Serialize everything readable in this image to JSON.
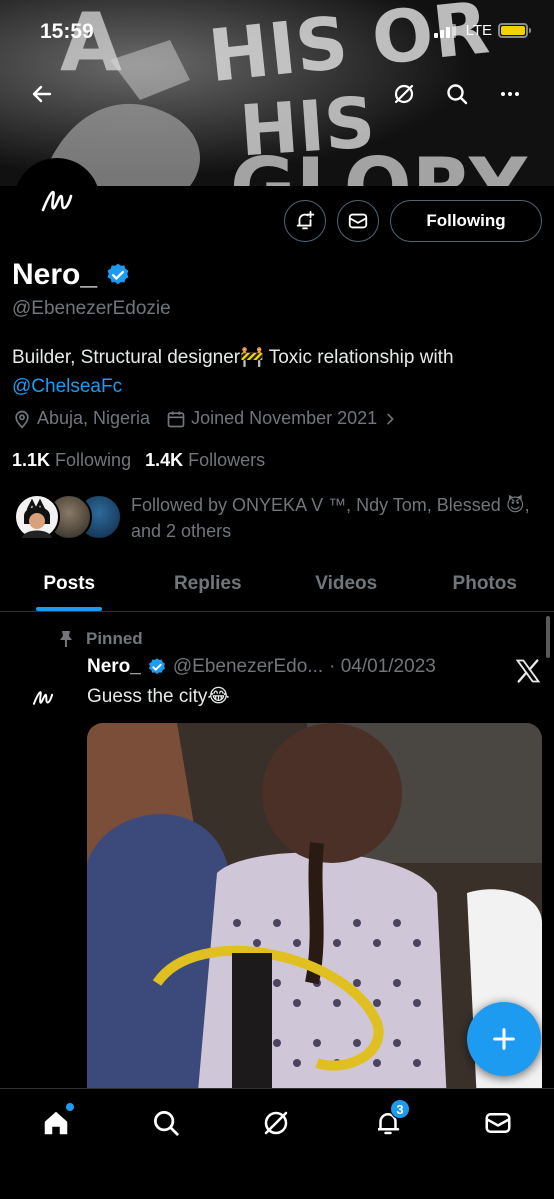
{
  "status_bar": {
    "time": "15:59",
    "network": "LTE"
  },
  "banner": {
    "art_text": [
      "A",
      "HIS OR",
      "HIS",
      "GLORY"
    ]
  },
  "profile": {
    "name": "Nero_",
    "handle": "@EbenezerEdozie",
    "bio_text": "Builder, Structural designer🚧 Toxic relationship with",
    "bio_link": "@ChelseaFc",
    "location": "Abuja, Nigeria",
    "joined": "Joined November 2021",
    "following_count": "1.1K",
    "following_label": "Following",
    "followers_count": "1.4K",
    "followers_label": "Followers",
    "followed_by_text": "Followed by ONYEKA V ™, Ndy Tom, Blessed 😈, and 2 others",
    "follow_button_label": "Following"
  },
  "tabs": [
    {
      "label": "Posts",
      "active": true
    },
    {
      "label": "Replies",
      "active": false
    },
    {
      "label": "Videos",
      "active": false
    },
    {
      "label": "Photos",
      "active": false
    }
  ],
  "pinned_post": {
    "pinned_label": "Pinned",
    "author_name": "Nero_",
    "author_handle": "@EbenezerEdo...",
    "date": "· 04/01/2023",
    "text": "Guess the city😂"
  },
  "bottom_nav": {
    "notifications_badge": "3"
  },
  "colors": {
    "accent": "#1d9bf0",
    "background": "#000000",
    "muted": "#71767b",
    "text": "#e7e9ea"
  },
  "icons": [
    "back-arrow-icon",
    "grok-icon",
    "search-icon",
    "more-icon",
    "notification-plus-icon",
    "message-icon",
    "verified-icon",
    "location-icon",
    "calendar-icon",
    "chevron-right-icon",
    "pin-icon",
    "x-logo-icon",
    "plus-icon",
    "home-icon",
    "communities-icon",
    "bell-icon",
    "mail-icon"
  ]
}
